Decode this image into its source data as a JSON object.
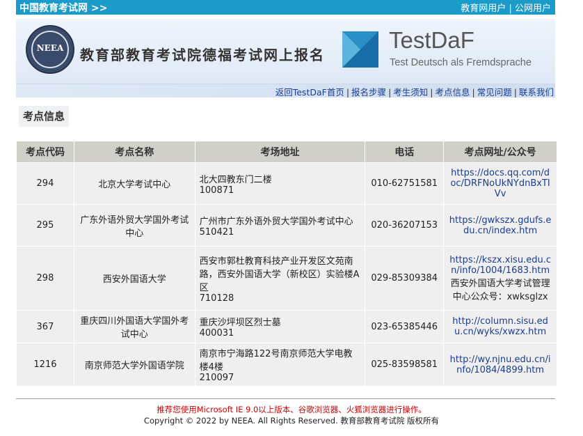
{
  "topbar": {
    "site_link": "中国教育考试网 >>",
    "edu_user": "教育网用户",
    "divider": "|",
    "public_user": "公网用户"
  },
  "banner": {
    "logo_text": "NEEA",
    "title": "教育部教育考试院德福考试网上报名",
    "testdaf_name": "TestDaF",
    "testdaf_sub": "Test Deutsch als Fremdsprache"
  },
  "nav": {
    "items": [
      "返回TestDaF首页",
      "报名步骤",
      "考生须知",
      "考点信息",
      "常见问题",
      "联系我们"
    ]
  },
  "section_title": "考点信息",
  "table": {
    "headers": [
      "考点代码",
      "考点名称",
      "考场地址",
      "电话",
      "考点网址/公众号"
    ],
    "rows": [
      {
        "code": "294",
        "name": "北京大学考试中心",
        "address": "北大四教东门二楼",
        "zip": "100871",
        "phone": "010-62751581",
        "web": "https://docs.qq.com/doc/DRFNoUkNYdnBxTIVv",
        "extra": ""
      },
      {
        "code": "295",
        "name": "广东外语外贸大学国外考试中心",
        "address": "广州市广东外语外贸大学国外考试中心",
        "zip": "510421",
        "phone": "020-36207153",
        "web": "https://gwkszx.gdufs.edu.cn/index.htm",
        "extra": ""
      },
      {
        "code": "298",
        "name": "西安外国语大学",
        "address": "西安市郭杜教育科技产业开发区文苑南路，西安外国语大学（新校区）实验楼A区",
        "zip": "710128",
        "phone": "029-85309384",
        "web": "https://kszx.xisu.edu.cn/info/1004/1683.htm",
        "extra": "西安外国语大学考试管理中心公众号：xwksglzx"
      },
      {
        "code": "367",
        "name": "重庆四川外国语大学国外考试中心",
        "address": "重庆沙坪坝区烈士墓",
        "zip": "400031",
        "phone": "023-65385446",
        "web": "http://column.sisu.edu.cn/wyks/xwzx.htm",
        "extra": ""
      },
      {
        "code": "1216",
        "name": "南京师范大学外国语学院",
        "address": "南京市宁海路122号南京师范大学电教楼4楼",
        "zip": "210097",
        "phone": "025-83598581",
        "web": "http://wy.njnu.edu.cn/info/1084/4899.htm",
        "extra": ""
      }
    ]
  },
  "footer": {
    "notice": "推荐您使用Microsoft IE 9.0以上版本、谷歌浏览器、火狐浏览器进行操作。",
    "copyright": "Copyright © 2022 by NEEA. All Rights Reserved. 教育部教育考试院 版权所有"
  },
  "colors": {
    "topbar": "#1b9bc9",
    "table_header": "#d0d0c9",
    "table_cell": "#efefef",
    "link": "#1a3d8f",
    "notice": "#cc0000"
  }
}
